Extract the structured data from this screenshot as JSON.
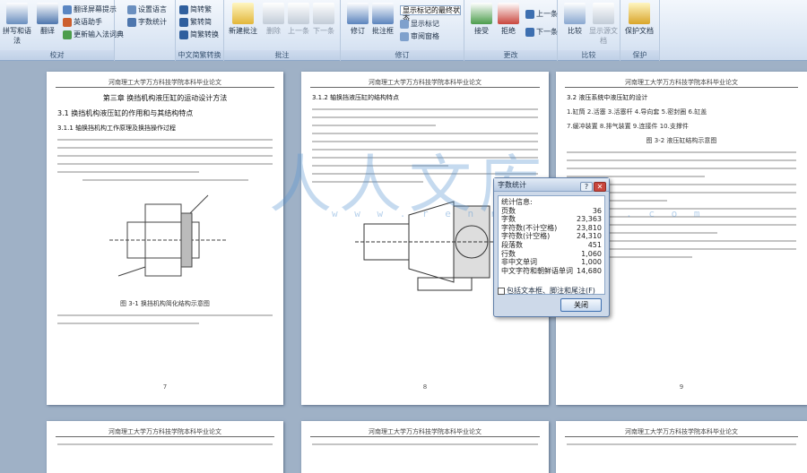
{
  "ribbon": {
    "groups": [
      {
        "label": "校对",
        "big": [
          "拼写和语法",
          "翻译"
        ],
        "small": [
          "翻译屏幕提示",
          "英语助手",
          "更新输入法词典"
        ]
      },
      {
        "label": "中文简繁转换",
        "small": [
          "简转繁",
          "繁转简",
          "简繁转换"
        ]
      },
      {
        "label": "批注",
        "big": [
          "新建批注",
          "删除",
          "上一条",
          "下一条"
        ]
      },
      {
        "label": "修订",
        "big": [
          "修订",
          "批注框"
        ],
        "dropdown": "显示标记的最终状态",
        "small": [
          "显示标记",
          "审阅窗格"
        ]
      },
      {
        "label": "更改",
        "big": [
          "接受",
          "拒绝"
        ],
        "small": [
          "上一条",
          "下一条"
        ]
      },
      {
        "label": "比较",
        "big": [
          "比较",
          "显示源文档"
        ]
      },
      {
        "label": "保护",
        "big": [
          "保护文档"
        ]
      }
    ],
    "extra_small": [
      "设置语言",
      "字数统计"
    ]
  },
  "pages": [
    {
      "header": "河南理工大学万方科技学院本科毕业论文",
      "lines": [
        "第三章 换挡机构液压缸的运动设计方法",
        "3.1 换挡机构液压缸的作用和与其结构特点",
        "3.1.1 轴换挡机构工作原理及换挡操作过程"
      ],
      "caption": "图 3-1  换挡机构简化结构示意图",
      "page_number": "7"
    },
    {
      "header": "河南理工大学万方科技学院本科毕业论文",
      "lines": [
        "3.1.2 轴换挡液压缸的结构特点"
      ],
      "page_number": "8"
    },
    {
      "header": "河南理工大学万方科技学院本科毕业论文",
      "lines": [
        "3.2 液压系统中液压缸的设计",
        "1.缸筒   2.活塞   3.活塞杆   4.导向套   5.密封圈   6.缸盖",
        "7.缓冲装置   8.排气装置   9.连接件   10.支撑件",
        "图 3-2 液压缸结构示意图"
      ],
      "page_number": "9"
    },
    {
      "header": "河南理工大学万方科技学院本科毕业论文"
    },
    {
      "header": "河南理工大学万方科技学院本科毕业论文"
    },
    {
      "header": "河南理工大学万方科技学院本科毕业论文"
    }
  ],
  "dialog": {
    "title": "字数统计",
    "stats": [
      {
        "label": "统计信息:",
        "value": ""
      },
      {
        "label": "页数",
        "value": "36"
      },
      {
        "label": "字数",
        "value": "23,363"
      },
      {
        "label": "字符数(不计空格)",
        "value": "23,810"
      },
      {
        "label": "字符数(计空格)",
        "value": "24,310"
      },
      {
        "label": "段落数",
        "value": "451"
      },
      {
        "label": "行数",
        "value": "1,060"
      },
      {
        "label": "非中文单词",
        "value": "1,000"
      },
      {
        "label": "中文字符和朝鲜语单词",
        "value": "14,680"
      }
    ],
    "checkbox_label": "包括文本框、脚注和尾注(F)",
    "ok_label": "关闭"
  },
  "watermark": {
    "main": "人人文库",
    "url": "w w w . r e n r e n d o c . c o m"
  }
}
